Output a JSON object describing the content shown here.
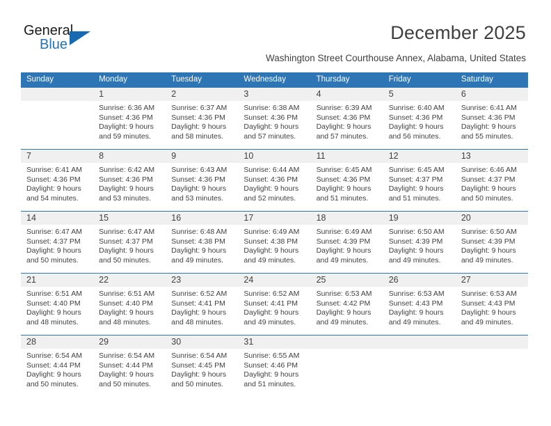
{
  "brand": {
    "name_part1": "General",
    "name_part2": "Blue",
    "triangle_color": "#1769b0",
    "blue": "#2472b8"
  },
  "header": {
    "title": "December 2025",
    "subtitle": "Washington Street Courthouse Annex, Alabama, United States"
  },
  "theme": {
    "header_blue": "#2e75b6",
    "daynum_band": "#f0f0f0",
    "text": "#3f3f3f"
  },
  "weekday_headers": [
    "Sunday",
    "Monday",
    "Tuesday",
    "Wednesday",
    "Thursday",
    "Friday",
    "Saturday"
  ],
  "weeks": [
    [
      {
        "day": "",
        "blank": true,
        "sunrise": "",
        "sunset": "",
        "daylight_line1": "",
        "daylight_line2": ""
      },
      {
        "day": "1",
        "sunrise": "Sunrise: 6:36 AM",
        "sunset": "Sunset: 4:36 PM",
        "daylight_line1": "Daylight: 9 hours",
        "daylight_line2": "and 59 minutes."
      },
      {
        "day": "2",
        "sunrise": "Sunrise: 6:37 AM",
        "sunset": "Sunset: 4:36 PM",
        "daylight_line1": "Daylight: 9 hours",
        "daylight_line2": "and 58 minutes."
      },
      {
        "day": "3",
        "sunrise": "Sunrise: 6:38 AM",
        "sunset": "Sunset: 4:36 PM",
        "daylight_line1": "Daylight: 9 hours",
        "daylight_line2": "and 57 minutes."
      },
      {
        "day": "4",
        "sunrise": "Sunrise: 6:39 AM",
        "sunset": "Sunset: 4:36 PM",
        "daylight_line1": "Daylight: 9 hours",
        "daylight_line2": "and 57 minutes."
      },
      {
        "day": "5",
        "sunrise": "Sunrise: 6:40 AM",
        "sunset": "Sunset: 4:36 PM",
        "daylight_line1": "Daylight: 9 hours",
        "daylight_line2": "and 56 minutes."
      },
      {
        "day": "6",
        "sunrise": "Sunrise: 6:41 AM",
        "sunset": "Sunset: 4:36 PM",
        "daylight_line1": "Daylight: 9 hours",
        "daylight_line2": "and 55 minutes."
      }
    ],
    [
      {
        "day": "7",
        "sunrise": "Sunrise: 6:41 AM",
        "sunset": "Sunset: 4:36 PM",
        "daylight_line1": "Daylight: 9 hours",
        "daylight_line2": "and 54 minutes."
      },
      {
        "day": "8",
        "sunrise": "Sunrise: 6:42 AM",
        "sunset": "Sunset: 4:36 PM",
        "daylight_line1": "Daylight: 9 hours",
        "daylight_line2": "and 53 minutes."
      },
      {
        "day": "9",
        "sunrise": "Sunrise: 6:43 AM",
        "sunset": "Sunset: 4:36 PM",
        "daylight_line1": "Daylight: 9 hours",
        "daylight_line2": "and 53 minutes."
      },
      {
        "day": "10",
        "sunrise": "Sunrise: 6:44 AM",
        "sunset": "Sunset: 4:36 PM",
        "daylight_line1": "Daylight: 9 hours",
        "daylight_line2": "and 52 minutes."
      },
      {
        "day": "11",
        "sunrise": "Sunrise: 6:45 AM",
        "sunset": "Sunset: 4:36 PM",
        "daylight_line1": "Daylight: 9 hours",
        "daylight_line2": "and 51 minutes."
      },
      {
        "day": "12",
        "sunrise": "Sunrise: 6:45 AM",
        "sunset": "Sunset: 4:37 PM",
        "daylight_line1": "Daylight: 9 hours",
        "daylight_line2": "and 51 minutes."
      },
      {
        "day": "13",
        "sunrise": "Sunrise: 6:46 AM",
        "sunset": "Sunset: 4:37 PM",
        "daylight_line1": "Daylight: 9 hours",
        "daylight_line2": "and 50 minutes."
      }
    ],
    [
      {
        "day": "14",
        "sunrise": "Sunrise: 6:47 AM",
        "sunset": "Sunset: 4:37 PM",
        "daylight_line1": "Daylight: 9 hours",
        "daylight_line2": "and 50 minutes."
      },
      {
        "day": "15",
        "sunrise": "Sunrise: 6:47 AM",
        "sunset": "Sunset: 4:37 PM",
        "daylight_line1": "Daylight: 9 hours",
        "daylight_line2": "and 50 minutes."
      },
      {
        "day": "16",
        "sunrise": "Sunrise: 6:48 AM",
        "sunset": "Sunset: 4:38 PM",
        "daylight_line1": "Daylight: 9 hours",
        "daylight_line2": "and 49 minutes."
      },
      {
        "day": "17",
        "sunrise": "Sunrise: 6:49 AM",
        "sunset": "Sunset: 4:38 PM",
        "daylight_line1": "Daylight: 9 hours",
        "daylight_line2": "and 49 minutes."
      },
      {
        "day": "18",
        "sunrise": "Sunrise: 6:49 AM",
        "sunset": "Sunset: 4:39 PM",
        "daylight_line1": "Daylight: 9 hours",
        "daylight_line2": "and 49 minutes."
      },
      {
        "day": "19",
        "sunrise": "Sunrise: 6:50 AM",
        "sunset": "Sunset: 4:39 PM",
        "daylight_line1": "Daylight: 9 hours",
        "daylight_line2": "and 49 minutes."
      },
      {
        "day": "20",
        "sunrise": "Sunrise: 6:50 AM",
        "sunset": "Sunset: 4:39 PM",
        "daylight_line1": "Daylight: 9 hours",
        "daylight_line2": "and 49 minutes."
      }
    ],
    [
      {
        "day": "21",
        "sunrise": "Sunrise: 6:51 AM",
        "sunset": "Sunset: 4:40 PM",
        "daylight_line1": "Daylight: 9 hours",
        "daylight_line2": "and 48 minutes."
      },
      {
        "day": "22",
        "sunrise": "Sunrise: 6:51 AM",
        "sunset": "Sunset: 4:40 PM",
        "daylight_line1": "Daylight: 9 hours",
        "daylight_line2": "and 48 minutes."
      },
      {
        "day": "23",
        "sunrise": "Sunrise: 6:52 AM",
        "sunset": "Sunset: 4:41 PM",
        "daylight_line1": "Daylight: 9 hours",
        "daylight_line2": "and 48 minutes."
      },
      {
        "day": "24",
        "sunrise": "Sunrise: 6:52 AM",
        "sunset": "Sunset: 4:41 PM",
        "daylight_line1": "Daylight: 9 hours",
        "daylight_line2": "and 49 minutes."
      },
      {
        "day": "25",
        "sunrise": "Sunrise: 6:53 AM",
        "sunset": "Sunset: 4:42 PM",
        "daylight_line1": "Daylight: 9 hours",
        "daylight_line2": "and 49 minutes."
      },
      {
        "day": "26",
        "sunrise": "Sunrise: 6:53 AM",
        "sunset": "Sunset: 4:43 PM",
        "daylight_line1": "Daylight: 9 hours",
        "daylight_line2": "and 49 minutes."
      },
      {
        "day": "27",
        "sunrise": "Sunrise: 6:53 AM",
        "sunset": "Sunset: 4:43 PM",
        "daylight_line1": "Daylight: 9 hours",
        "daylight_line2": "and 49 minutes."
      }
    ],
    [
      {
        "day": "28",
        "sunrise": "Sunrise: 6:54 AM",
        "sunset": "Sunset: 4:44 PM",
        "daylight_line1": "Daylight: 9 hours",
        "daylight_line2": "and 50 minutes."
      },
      {
        "day": "29",
        "sunrise": "Sunrise: 6:54 AM",
        "sunset": "Sunset: 4:44 PM",
        "daylight_line1": "Daylight: 9 hours",
        "daylight_line2": "and 50 minutes."
      },
      {
        "day": "30",
        "sunrise": "Sunrise: 6:54 AM",
        "sunset": "Sunset: 4:45 PM",
        "daylight_line1": "Daylight: 9 hours",
        "daylight_line2": "and 50 minutes."
      },
      {
        "day": "31",
        "sunrise": "Sunrise: 6:55 AM",
        "sunset": "Sunset: 4:46 PM",
        "daylight_line1": "Daylight: 9 hours",
        "daylight_line2": "and 51 minutes."
      },
      {
        "day": "",
        "blank": true,
        "sunrise": "",
        "sunset": "",
        "daylight_line1": "",
        "daylight_line2": ""
      },
      {
        "day": "",
        "blank": true,
        "sunrise": "",
        "sunset": "",
        "daylight_line1": "",
        "daylight_line2": ""
      },
      {
        "day": "",
        "blank": true,
        "sunrise": "",
        "sunset": "",
        "daylight_line1": "",
        "daylight_line2": ""
      }
    ]
  ]
}
